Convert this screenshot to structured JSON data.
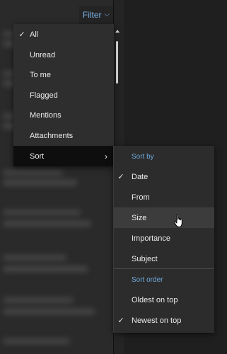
{
  "filter_button": {
    "label": "Filter",
    "chevron": "⌵"
  },
  "menu": {
    "items": [
      {
        "label": "All",
        "checked": true
      },
      {
        "label": "Unread",
        "checked": false
      },
      {
        "label": "To me",
        "checked": false
      },
      {
        "label": "Flagged",
        "checked": false
      },
      {
        "label": "Mentions",
        "checked": false
      },
      {
        "label": "Attachments",
        "checked": false
      },
      {
        "label": "Sort",
        "has_submenu": true
      }
    ]
  },
  "submenu": {
    "sort_by_header": "Sort by",
    "sort_by": [
      {
        "label": "Date",
        "checked": true
      },
      {
        "label": "From",
        "checked": false
      },
      {
        "label": "Size",
        "checked": false
      },
      {
        "label": "Importance",
        "checked": false
      },
      {
        "label": "Subject",
        "checked": false
      }
    ],
    "sort_order_header": "Sort order",
    "sort_order": [
      {
        "label": "Oldest on top",
        "checked": false
      },
      {
        "label": "Newest on top",
        "checked": true
      }
    ]
  },
  "icons": {
    "check": "✓",
    "chevron_right": "›",
    "chevron_down": "⌵"
  },
  "colors": {
    "accent": "#7ab2e6",
    "menu_bg": "#2e2e2e",
    "selected_bg": "#0e0e0e",
    "hover_bg": "#3c3c3c"
  }
}
